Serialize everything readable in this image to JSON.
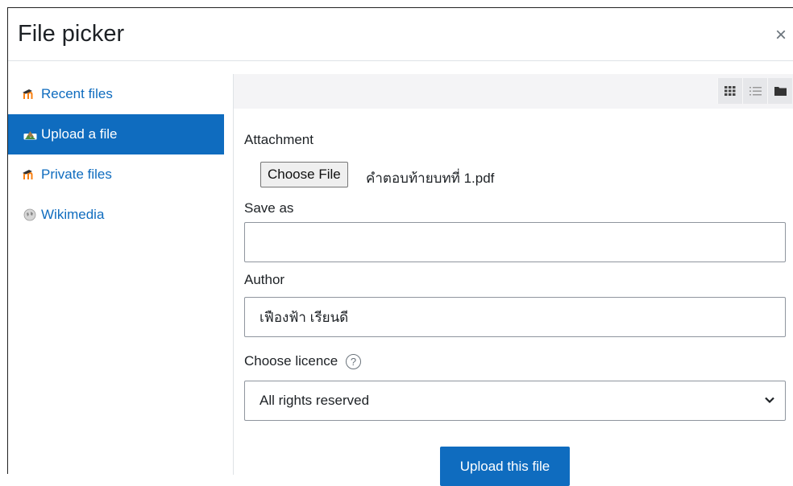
{
  "dialog": {
    "title": "File picker",
    "close_label": "×"
  },
  "sidebar": {
    "items": [
      {
        "label": "Recent files",
        "icon": "moodle-icon"
      },
      {
        "label": "Upload a file",
        "icon": "upload-icon",
        "active": true
      },
      {
        "label": "Private files",
        "icon": "moodle-icon"
      },
      {
        "label": "Wikimedia",
        "icon": "wikimedia-icon"
      }
    ]
  },
  "toolbar": {
    "views": [
      "grid-view-icon",
      "list-view-icon",
      "folder-view-icon"
    ]
  },
  "form": {
    "attachment_label": "Attachment",
    "choose_file_label": "Choose File",
    "file_name": "คำตอบท้ายบทที่ 1.pdf",
    "save_as_label": "Save as",
    "save_as_value": "",
    "author_label": "Author",
    "author_value": "เฟืองฟ้า เรียนดี",
    "licence_label": "Choose licence",
    "licence_help": "?",
    "licence_value": "All rights reserved",
    "upload_label": "Upload this file"
  },
  "colors": {
    "accent": "#0f6cbf",
    "text": "#1d2125",
    "border": "#8f959e"
  }
}
